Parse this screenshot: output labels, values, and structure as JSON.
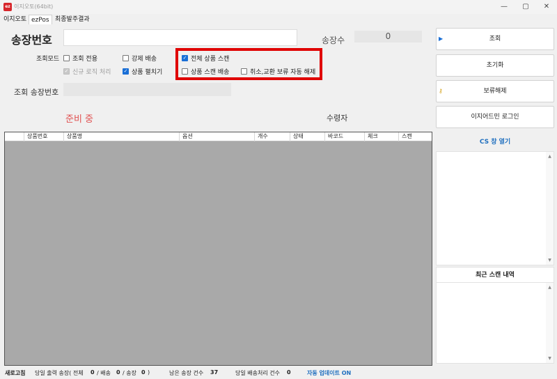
{
  "titlebar": {
    "logo": "ez",
    "title": "이지오토(64bit)",
    "minimize": "—",
    "maximize": "▢",
    "close": "✕"
  },
  "menu": {
    "items": [
      "이지오토",
      "ezPos",
      "최종발주결과"
    ],
    "active_index": 1
  },
  "form": {
    "invoice_label": "송장번호",
    "invoice_value": "",
    "count_label": "송장수",
    "count_value": "0",
    "mode_label": "조회모드",
    "checkboxes": [
      {
        "label": "조회 전용",
        "checked": false,
        "disabled": false
      },
      {
        "label": "강제 배송",
        "checked": false,
        "disabled": false
      },
      {
        "label": "전체 상품 스캔",
        "checked": true,
        "disabled": false
      },
      {
        "label": "신규 로직 처리",
        "checked": true,
        "disabled": true
      },
      {
        "label": "상품 펼치기",
        "checked": true,
        "disabled": false
      },
      {
        "label": "상품 스캔 배송",
        "checked": false,
        "disabled": false
      },
      {
        "label": "취소,교환 보류 자동 해제",
        "checked": false,
        "disabled": false
      }
    ],
    "search_invoice_label": "조회 송장번호",
    "search_invoice_value": "",
    "status_text": "준비 중",
    "recipient_label": "수령자"
  },
  "grid": {
    "columns": [
      "",
      "상품번호",
      "상품명",
      "옵션",
      "개수",
      "상태",
      "바코드",
      "체크",
      "스캔"
    ],
    "rows": []
  },
  "right_panel": {
    "buttons": [
      "조회",
      "초기화",
      "보류해제",
      "이지어드민 로그인"
    ],
    "cs_link": "CS 창 열기",
    "recent_scan_title": "최근 스캔 내역"
  },
  "footer": {
    "refresh": "새로고침",
    "today_output": "당일 출력 송장( 전체",
    "total": "0",
    "ship_label": "/ 배송",
    "ship": "0",
    "inv_label": "/ 송장",
    "inv": "0",
    "close_paren": ")",
    "remaining_label": "남은 송장 건수",
    "remaining": "37",
    "today_ship_label": "당일 배송처리 건수",
    "today_ship": "0",
    "auto_update": "자동 업데이트 ON"
  },
  "colors": {
    "accent_blue": "#1a6fd6",
    "link_blue": "#1f6fbf",
    "status_red": "#e05050",
    "highlight_red": "#e00000",
    "grid_bg": "#a9a9a9"
  }
}
